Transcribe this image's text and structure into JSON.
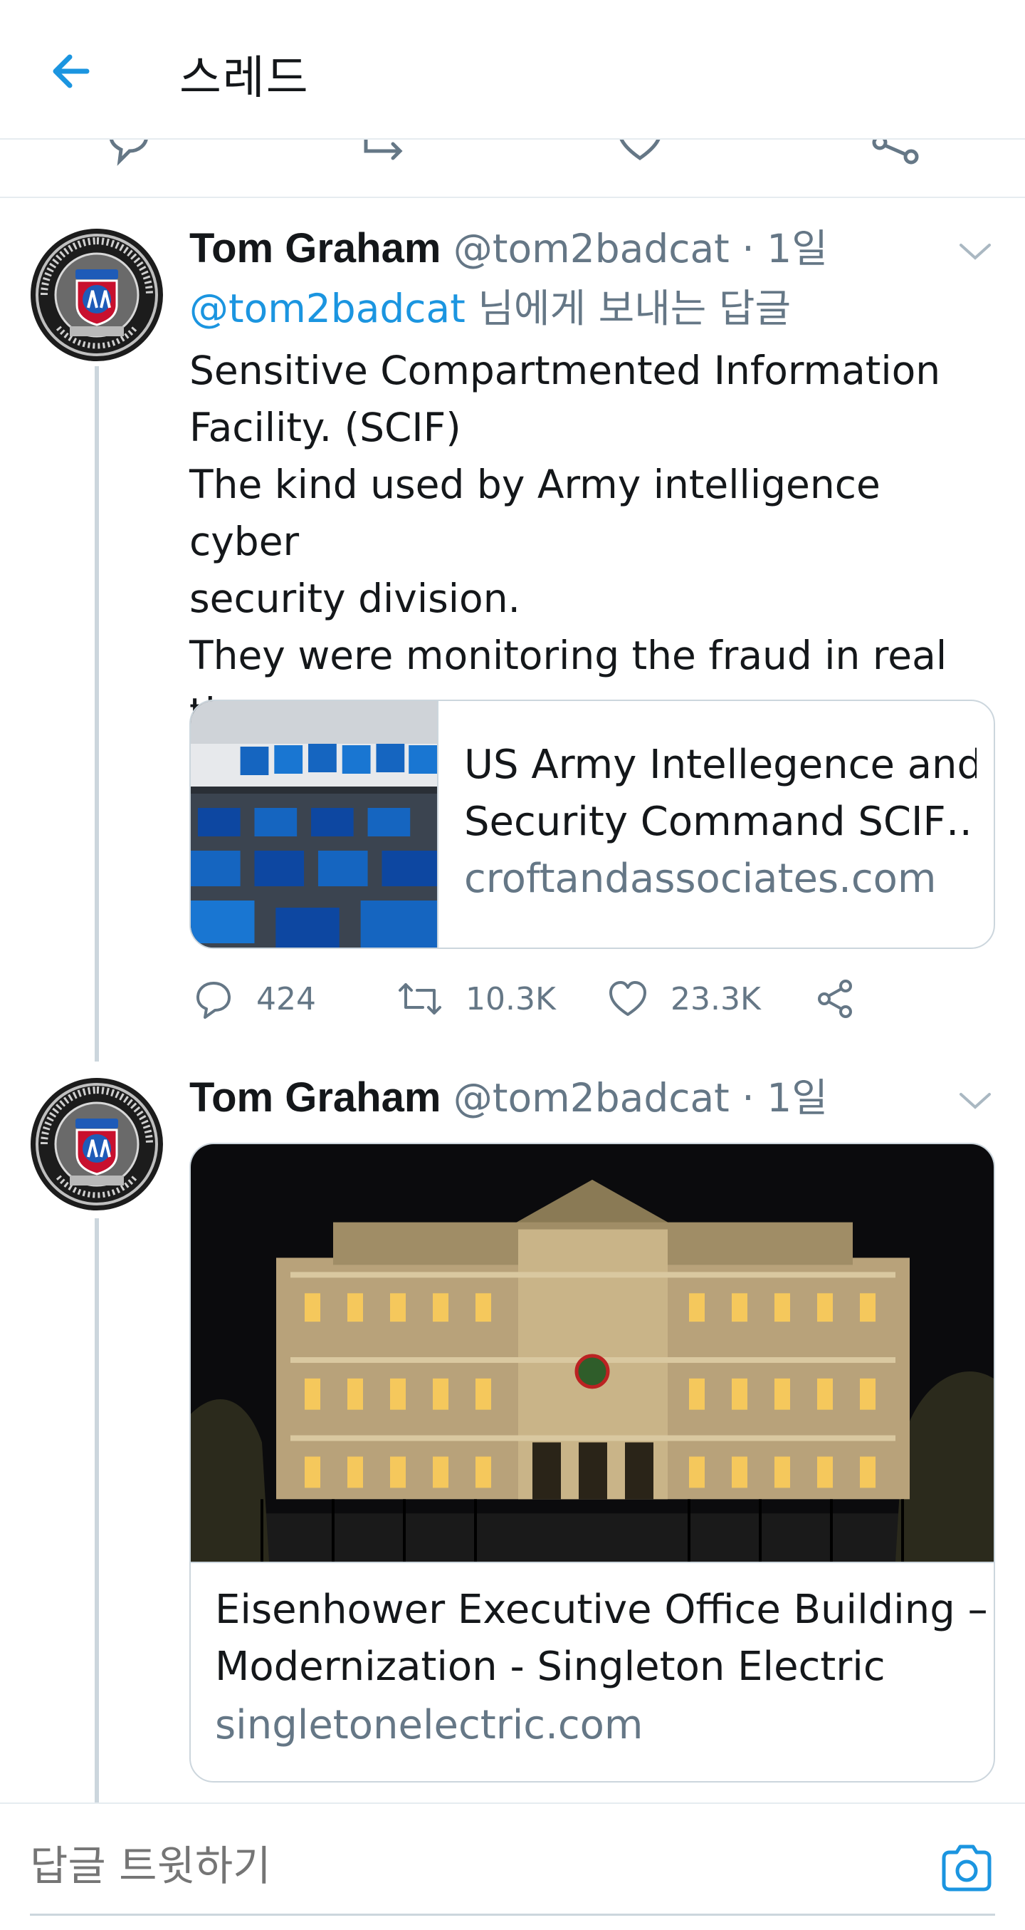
{
  "header": {
    "title": "스레드",
    "back_icon": "arrow-left-icon"
  },
  "colors": {
    "accent": "#1b95e0",
    "text": "#14171a",
    "muted": "#657786",
    "border": "#ccd6dd"
  },
  "tweets": [
    {
      "author_name": "Tom Graham",
      "handle": "@tom2badcat",
      "separator": "·",
      "time": "1일",
      "reply_mention": "@tom2badcat",
      "reply_suffix": " 님에게 보내는 답글",
      "text": "Sensitive Compartmented Information\nFacility. (SCIF)\nThe kind used by Army intelligence cyber\nsecurity division.\nThey were monitoring the fraud in real\ntime.",
      "card": {
        "title_line1": "US Army Intellegence and",
        "title_line2": "Security Command SCIF…",
        "domain": "croftandassociates.com"
      },
      "stats": {
        "replies": "424",
        "retweets": "10.3K",
        "likes": "23.3K"
      }
    },
    {
      "author_name": "Tom Graham",
      "handle": "@tom2badcat",
      "separator": "·",
      "time": "1일",
      "card": {
        "title_line1": "Eisenhower Executive Office Building –",
        "title_line2": "Modernization - Singleton Electric",
        "domain": "singletonelectric.com"
      }
    }
  ],
  "composer": {
    "placeholder": "답글 트윗하기",
    "camera_icon": "camera-icon"
  }
}
